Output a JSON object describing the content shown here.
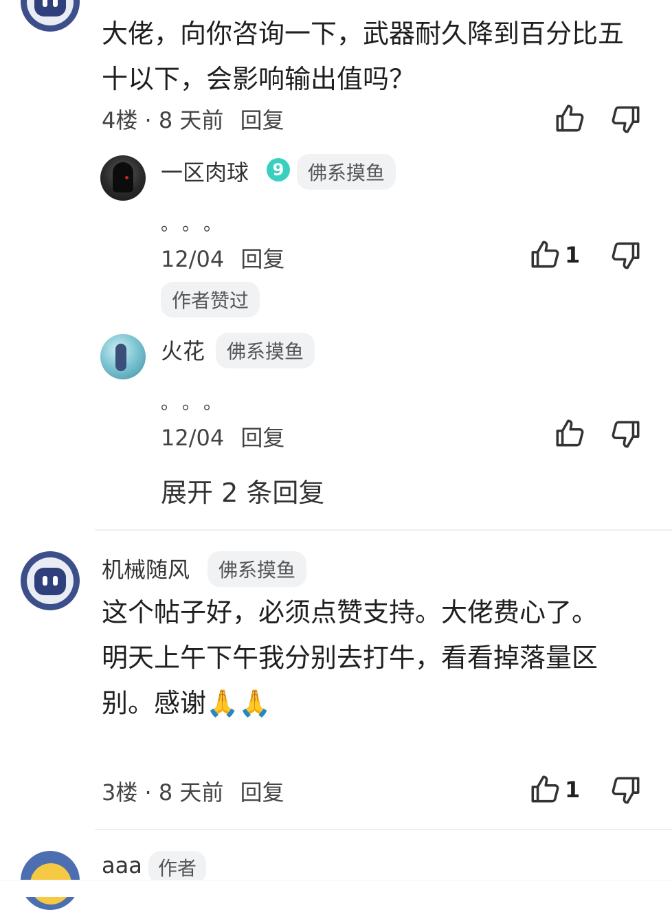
{
  "comments": [
    {
      "content": "大佬，向你咨询一下，武器耐久降到百分比五十以下，会影响输出值吗？",
      "floor_time": "4楼 · 8 天前",
      "reply_label": "回复",
      "replies": [
        {
          "name": "一区肉球",
          "level": "9",
          "tag": "佛系摸鱼",
          "content": "。。。",
          "date": "12/04",
          "reply_label": "回复",
          "likes": "1",
          "author_liked": "作者赞过"
        },
        {
          "name": "火花",
          "tag": "佛系摸鱼",
          "content": "。。。",
          "date": "12/04",
          "reply_label": "回复"
        }
      ],
      "expand_label": "展开 2 条回复"
    },
    {
      "name": "机械随风",
      "tag": "佛系摸鱼",
      "content_line1": "这个帖子好，必须点赞支持。大佬费心了。",
      "content_line2": "明天上午下午我分别去打牛，看看掉落量区别。感谢🙏🙏",
      "floor_time": "3楼 · 8 天前",
      "reply_label": "回复",
      "likes": "1"
    },
    {
      "name": "aaa",
      "tag": "作者"
    }
  ],
  "icons": {
    "like": "thumbs-up-icon",
    "dislike": "thumbs-down-icon"
  },
  "colors": {
    "level_badge": "#3ad0c0",
    "tag_bg": "#f1f2f4"
  }
}
